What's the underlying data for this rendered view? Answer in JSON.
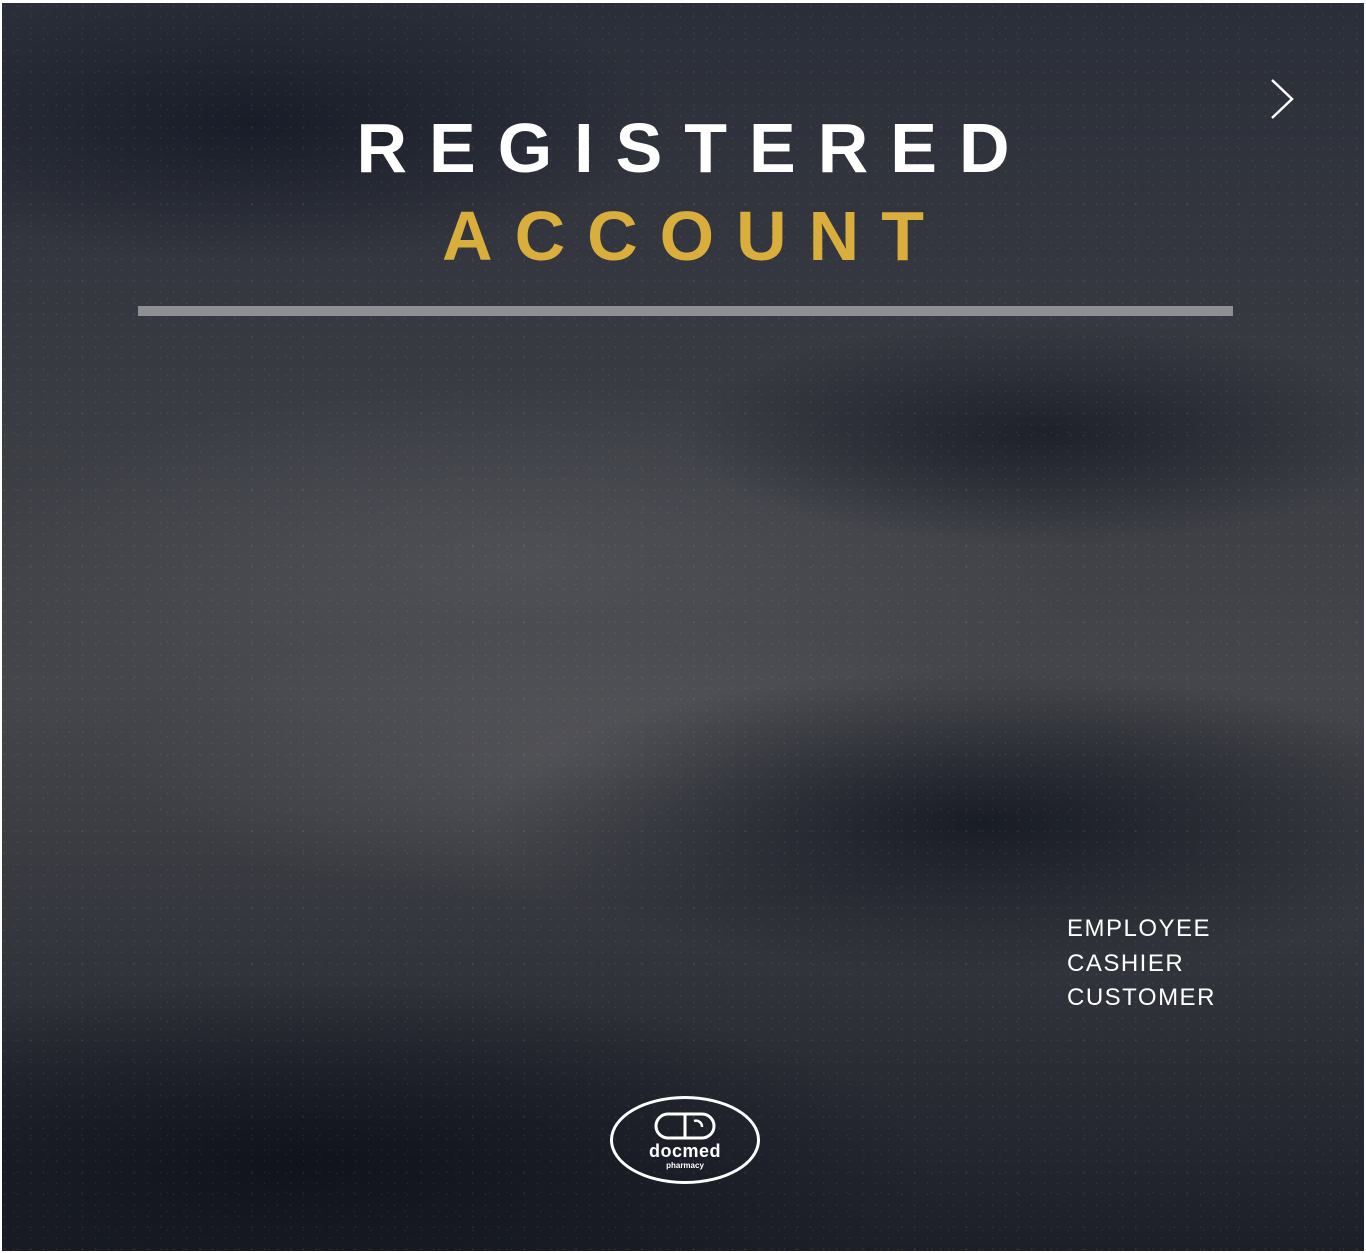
{
  "header": {
    "title_line1": "REGISTERED",
    "title_line2": "ACCOUNT",
    "accent_color": "#d9ae3c",
    "next_icon": "chevron-right-icon"
  },
  "roles": {
    "items": [
      "EMPLOYEE",
      "CASHIER",
      "CUSTOMER"
    ]
  },
  "logo": {
    "icon": "capsule-icon",
    "brand": "docmed",
    "tagline": "pharmacy"
  }
}
